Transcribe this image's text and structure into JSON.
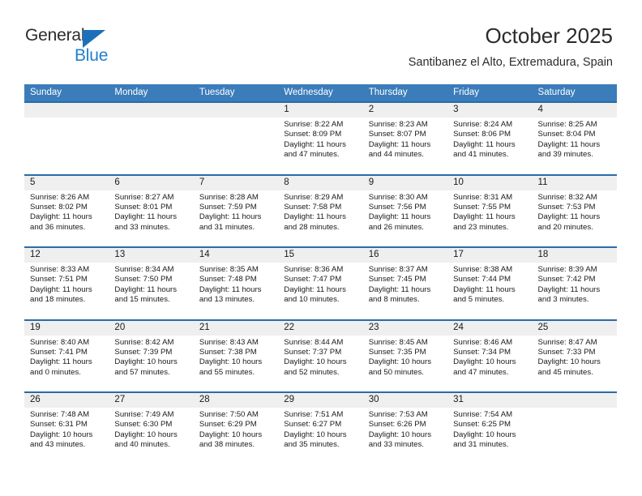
{
  "brand": {
    "name_line1": "General",
    "name_line2": "Blue",
    "triangle_icon": "triangle-icon",
    "colors": {
      "dark": "#2b2b2b",
      "blue": "#1f7fd0",
      "triangle": "#1e6fba"
    }
  },
  "header": {
    "title": "October 2025",
    "subtitle": "Santibanez el Alto, Extremadura, Spain"
  },
  "calendar": {
    "colors": {
      "header_bg": "#3b7cba",
      "header_text": "#ffffff",
      "week_rule": "#2a6ca8",
      "daterow_bg": "#efefef"
    },
    "weekdays": [
      "Sunday",
      "Monday",
      "Tuesday",
      "Wednesday",
      "Thursday",
      "Friday",
      "Saturday"
    ],
    "weeks": [
      [
        {
          "day": "",
          "info": ""
        },
        {
          "day": "",
          "info": ""
        },
        {
          "day": "",
          "info": ""
        },
        {
          "day": "1",
          "info": "Sunrise: 8:22 AM\nSunset: 8:09 PM\nDaylight: 11 hours\nand 47 minutes."
        },
        {
          "day": "2",
          "info": "Sunrise: 8:23 AM\nSunset: 8:07 PM\nDaylight: 11 hours\nand 44 minutes."
        },
        {
          "day": "3",
          "info": "Sunrise: 8:24 AM\nSunset: 8:06 PM\nDaylight: 11 hours\nand 41 minutes."
        },
        {
          "day": "4",
          "info": "Sunrise: 8:25 AM\nSunset: 8:04 PM\nDaylight: 11 hours\nand 39 minutes."
        }
      ],
      [
        {
          "day": "5",
          "info": "Sunrise: 8:26 AM\nSunset: 8:02 PM\nDaylight: 11 hours\nand 36 minutes."
        },
        {
          "day": "6",
          "info": "Sunrise: 8:27 AM\nSunset: 8:01 PM\nDaylight: 11 hours\nand 33 minutes."
        },
        {
          "day": "7",
          "info": "Sunrise: 8:28 AM\nSunset: 7:59 PM\nDaylight: 11 hours\nand 31 minutes."
        },
        {
          "day": "8",
          "info": "Sunrise: 8:29 AM\nSunset: 7:58 PM\nDaylight: 11 hours\nand 28 minutes."
        },
        {
          "day": "9",
          "info": "Sunrise: 8:30 AM\nSunset: 7:56 PM\nDaylight: 11 hours\nand 26 minutes."
        },
        {
          "day": "10",
          "info": "Sunrise: 8:31 AM\nSunset: 7:55 PM\nDaylight: 11 hours\nand 23 minutes."
        },
        {
          "day": "11",
          "info": "Sunrise: 8:32 AM\nSunset: 7:53 PM\nDaylight: 11 hours\nand 20 minutes."
        }
      ],
      [
        {
          "day": "12",
          "info": "Sunrise: 8:33 AM\nSunset: 7:51 PM\nDaylight: 11 hours\nand 18 minutes."
        },
        {
          "day": "13",
          "info": "Sunrise: 8:34 AM\nSunset: 7:50 PM\nDaylight: 11 hours\nand 15 minutes."
        },
        {
          "day": "14",
          "info": "Sunrise: 8:35 AM\nSunset: 7:48 PM\nDaylight: 11 hours\nand 13 minutes."
        },
        {
          "day": "15",
          "info": "Sunrise: 8:36 AM\nSunset: 7:47 PM\nDaylight: 11 hours\nand 10 minutes."
        },
        {
          "day": "16",
          "info": "Sunrise: 8:37 AM\nSunset: 7:45 PM\nDaylight: 11 hours\nand 8 minutes."
        },
        {
          "day": "17",
          "info": "Sunrise: 8:38 AM\nSunset: 7:44 PM\nDaylight: 11 hours\nand 5 minutes."
        },
        {
          "day": "18",
          "info": "Sunrise: 8:39 AM\nSunset: 7:42 PM\nDaylight: 11 hours\nand 3 minutes."
        }
      ],
      [
        {
          "day": "19",
          "info": "Sunrise: 8:40 AM\nSunset: 7:41 PM\nDaylight: 11 hours\nand 0 minutes."
        },
        {
          "day": "20",
          "info": "Sunrise: 8:42 AM\nSunset: 7:39 PM\nDaylight: 10 hours\nand 57 minutes."
        },
        {
          "day": "21",
          "info": "Sunrise: 8:43 AM\nSunset: 7:38 PM\nDaylight: 10 hours\nand 55 minutes."
        },
        {
          "day": "22",
          "info": "Sunrise: 8:44 AM\nSunset: 7:37 PM\nDaylight: 10 hours\nand 52 minutes."
        },
        {
          "day": "23",
          "info": "Sunrise: 8:45 AM\nSunset: 7:35 PM\nDaylight: 10 hours\nand 50 minutes."
        },
        {
          "day": "24",
          "info": "Sunrise: 8:46 AM\nSunset: 7:34 PM\nDaylight: 10 hours\nand 47 minutes."
        },
        {
          "day": "25",
          "info": "Sunrise: 8:47 AM\nSunset: 7:33 PM\nDaylight: 10 hours\nand 45 minutes."
        }
      ],
      [
        {
          "day": "26",
          "info": "Sunrise: 7:48 AM\nSunset: 6:31 PM\nDaylight: 10 hours\nand 43 minutes."
        },
        {
          "day": "27",
          "info": "Sunrise: 7:49 AM\nSunset: 6:30 PM\nDaylight: 10 hours\nand 40 minutes."
        },
        {
          "day": "28",
          "info": "Sunrise: 7:50 AM\nSunset: 6:29 PM\nDaylight: 10 hours\nand 38 minutes."
        },
        {
          "day": "29",
          "info": "Sunrise: 7:51 AM\nSunset: 6:27 PM\nDaylight: 10 hours\nand 35 minutes."
        },
        {
          "day": "30",
          "info": "Sunrise: 7:53 AM\nSunset: 6:26 PM\nDaylight: 10 hours\nand 33 minutes."
        },
        {
          "day": "31",
          "info": "Sunrise: 7:54 AM\nSunset: 6:25 PM\nDaylight: 10 hours\nand 31 minutes."
        },
        {
          "day": "",
          "info": ""
        }
      ]
    ]
  }
}
